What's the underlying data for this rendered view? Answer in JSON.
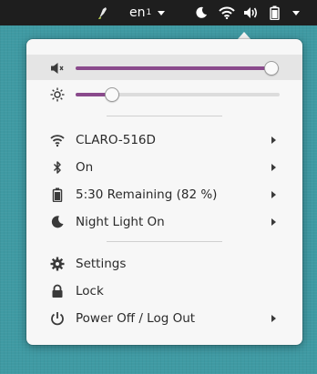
{
  "topbar": {
    "app_icon": "paint-brush-icon",
    "language": "en",
    "language_sub": "1",
    "indicators": [
      "moon-icon",
      "wifi-icon",
      "volume-icon",
      "battery-icon"
    ]
  },
  "sliders": {
    "volume": {
      "icon": "speaker-icon",
      "level": 0.96
    },
    "brightness": {
      "icon": "sun-icon",
      "level": 0.18
    }
  },
  "items": {
    "wifi": {
      "icon": "wifi-icon",
      "label": "CLARO-516D"
    },
    "bluetooth": {
      "icon": "bluetooth-icon",
      "label": "On"
    },
    "battery": {
      "icon": "battery-icon",
      "label": "5:30 Remaining (82 %)"
    },
    "nightlight": {
      "icon": "moon-icon",
      "label": "Night Light On"
    },
    "settings": {
      "icon": "gear-icon",
      "label": "Settings"
    },
    "lock": {
      "icon": "lock-icon",
      "label": "Lock"
    },
    "power": {
      "icon": "power-icon",
      "label": "Power Off / Log Out"
    }
  },
  "colors": {
    "accent": "#8a4a8c",
    "panel": "#1e1e1e",
    "desktop": "#3f9aa3",
    "menu_bg": "#f7f7f7"
  }
}
